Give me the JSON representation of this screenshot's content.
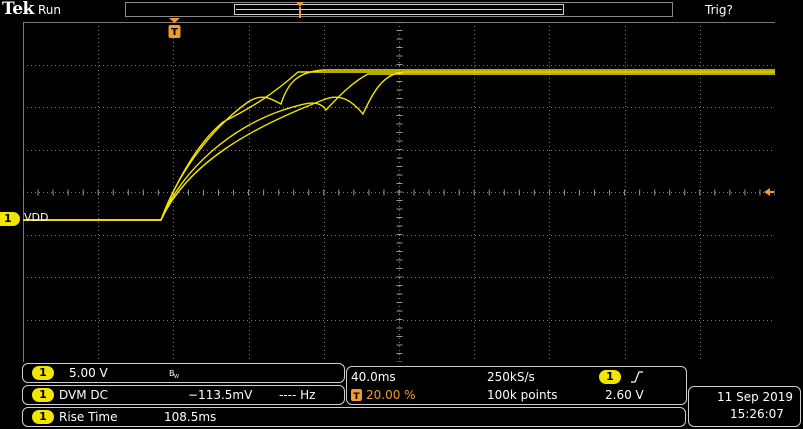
{
  "header": {
    "brand": "Tek",
    "run_status": "Run",
    "trigger_status": "Trig?"
  },
  "channel": {
    "number": "1",
    "label": "VDD",
    "scale": "5.00 V",
    "bw_icon": "bandwidth-limit-icon",
    "color": "#f2e500"
  },
  "measurements": {
    "dvm_label": "DVM DC",
    "dvm_value": "−113.5mV",
    "freq_value": "---- Hz",
    "rise_label": "Rise Time",
    "rise_value": "108.5ms"
  },
  "horizontal": {
    "timebase": "40.0ms",
    "sample_rate": "250kS/s",
    "trigger_position": "20.00 %",
    "record_length": "100k points"
  },
  "trigger": {
    "source": "1",
    "slope_icon": "rising-edge-icon",
    "level": "2.60 V"
  },
  "clock": {
    "date": "11 Sep  2019",
    "time": "15:26:07"
  },
  "icons": {
    "trigger_position": "trigger-position-icon",
    "trigger_level": "trigger-level-arrow-icon"
  },
  "colors": {
    "trace": "#f2e500",
    "accent": "#f39a2a",
    "grid": "#7a7a7a"
  }
}
